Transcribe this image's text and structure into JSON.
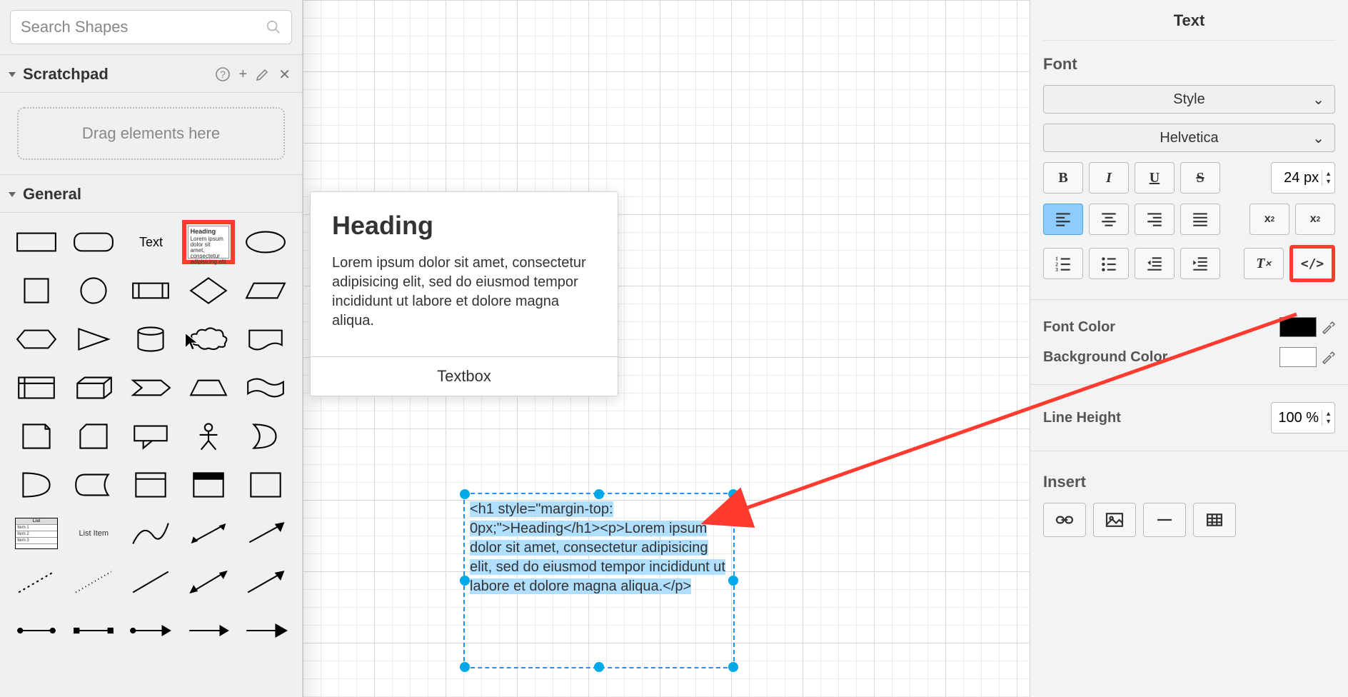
{
  "sidebar": {
    "search_placeholder": "Search Shapes",
    "scratchpad_title": "Scratchpad",
    "dropzone": "Drag elements here",
    "general_title": "General",
    "text_label": "Text",
    "listitem_label": "List Item",
    "highlight_heading": "Heading",
    "highlight_lorem": "Lorem ipsum dolor sit amet, consectetur adipisicing elit"
  },
  "canvas": {
    "card_heading": "Heading",
    "card_body": "Lorem ipsum dolor sit amet, consectetur adipisicing elit, sed do eiusmod tempor incididunt ut labore et dolore magna aliqua.",
    "card_footer": "Textbox",
    "selected_html": "<h1 style=\"margin-top: 0px;\">Heading</h1><p>Lorem ipsum dolor sit amet, consectetur adipisicing elit, sed do eiusmod tempor incididunt ut labore et dolore magna aliqua.</p>"
  },
  "right": {
    "panel_title": "Text",
    "group_font": "Font",
    "style_dropdown": "Style",
    "font_dropdown": "Helvetica",
    "font_size": "24 px",
    "font_color_label": "Font Color",
    "bg_color_label": "Background Color",
    "line_height_label": "Line Height",
    "line_height_value": "100 %",
    "insert_label": "Insert",
    "font_color": "#000000",
    "bg_color": "#FFFFFF"
  },
  "colors": {
    "highlight": "#ff3b2f",
    "selection": "#1e90ff"
  }
}
